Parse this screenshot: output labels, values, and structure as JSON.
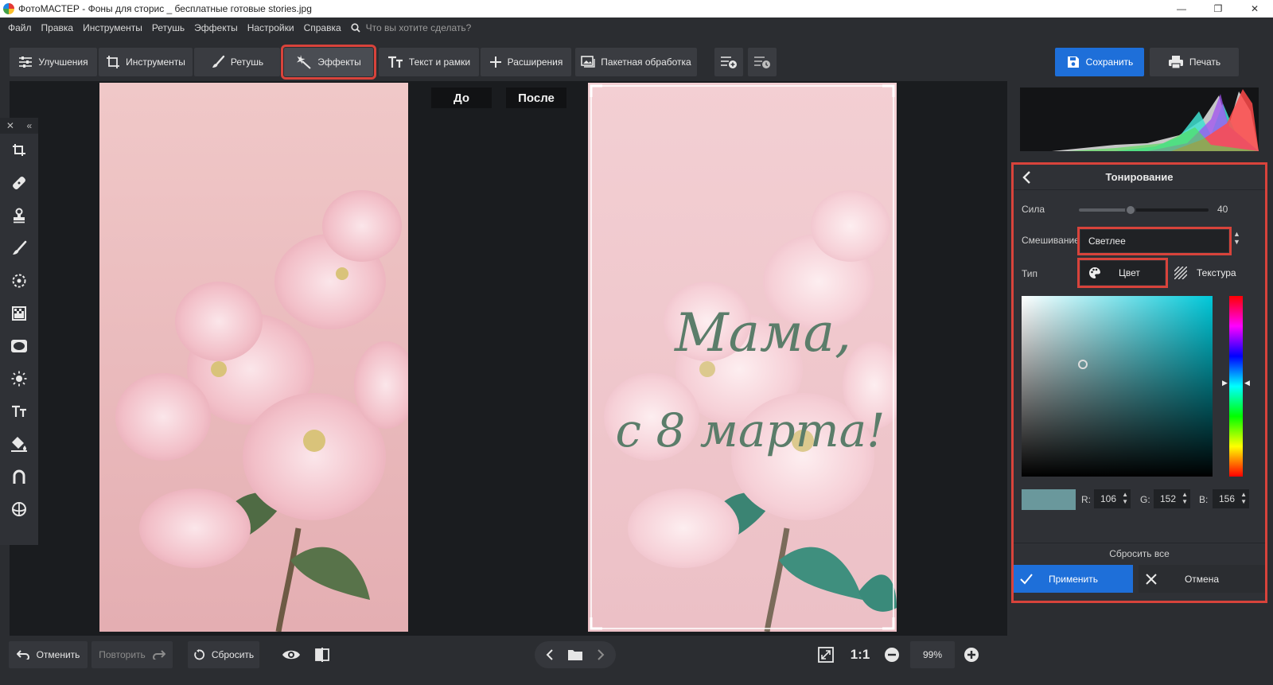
{
  "window": {
    "title": "ФотоМАСТЕР - Фоны для сторис _ бесплатные готовые stories.jpg",
    "controls": [
      "—",
      "❐",
      "✕"
    ]
  },
  "menu": {
    "items": [
      "Файл",
      "Правка",
      "Инструменты",
      "Ретушь",
      "Эффекты",
      "Настройки",
      "Справка"
    ],
    "search_placeholder": "Что вы хотите сделать?"
  },
  "toolbar": {
    "enhancements": "Улучшения",
    "tools": "Инструменты",
    "retouch": "Ретушь",
    "effects": "Эффекты",
    "text_frames": "Текст и рамки",
    "extensions": "Расширения",
    "batch": "Пакетная обработка",
    "save": "Сохранить",
    "print": "Печать"
  },
  "canvas": {
    "before_label": "До",
    "after_label": "После",
    "greeting_line1": "Мама,",
    "greeting_line2": "с 8 марта!"
  },
  "toning": {
    "title": "Тонирование",
    "strength_label": "Сила",
    "strength_value": "40",
    "strength_level": 0.4,
    "blend_label": "Смешивание",
    "blend_value": "Светлее",
    "type_label": "Тип",
    "type_color": "Цвет",
    "type_texture": "Текстура",
    "swatch_color": "#6a989c",
    "r_label": "R:",
    "r_value": "106",
    "g_label": "G:",
    "g_value": "152",
    "b_label": "B:",
    "b_value": "156",
    "reset_all": "Сбросить все",
    "apply": "Применить",
    "cancel": "Отмена"
  },
  "bottom": {
    "undo": "Отменить",
    "redo": "Повторить",
    "reset": "Сбросить",
    "ratio": "1:1",
    "zoom": "99%"
  },
  "colors": {
    "accent": "#1e6fd9",
    "highlight": "#d8433b",
    "greeting_text": "#5b7d6a"
  }
}
